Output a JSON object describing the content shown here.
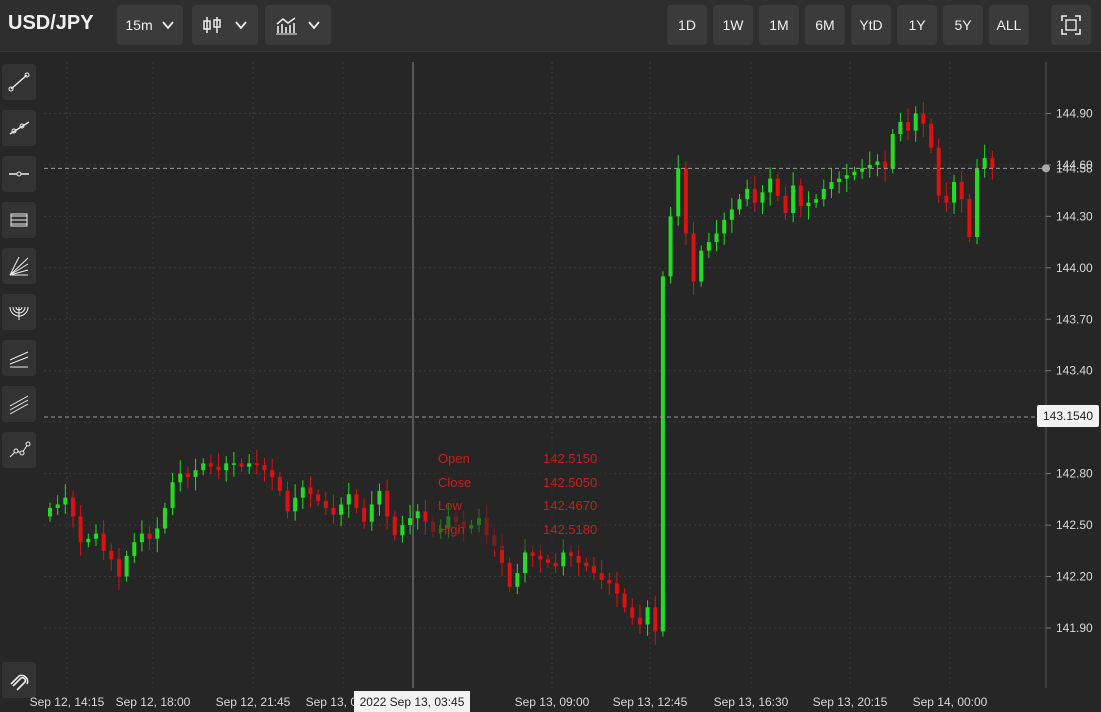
{
  "toolbar": {
    "symbol": "USD/JPY",
    "interval": "15m",
    "chart_type_icon": "candlestick-icon",
    "indicators_icon": "indicators-icon",
    "ranges": [
      "1D",
      "1W",
      "1M",
      "6M",
      "YtD",
      "1Y",
      "5Y",
      "ALL"
    ],
    "fullscreen_icon": "fullscreen-icon"
  },
  "sidebar": {
    "tools": [
      "trendline-icon",
      "ray-icon",
      "horizontal-line-icon",
      "channel-icon",
      "fan-icon",
      "arc-icon",
      "parallel-channel-icon",
      "pitchfork-icon",
      "path-icon"
    ],
    "bottom_tool": "magnet-icon"
  },
  "colors": {
    "up": "#22dd22",
    "down": "#dd1111",
    "background": "#262626",
    "grid": "#3a3a3a"
  },
  "tooltip": {
    "open_label": "Open",
    "open_value": "142.5150",
    "close_label": "Close",
    "close_value": "142.5050",
    "low_label": "Low",
    "low_value": "142.4670",
    "high_label": "High",
    "high_value": "142.5180"
  },
  "crosshair": {
    "price": "143.1540",
    "time": "2022 Sep 13, 03:45"
  },
  "last_price_label": "144.58",
  "chart_data": {
    "type": "candlestick",
    "y_ticks": [
      "144.90",
      "144.60",
      "144.30",
      "144.00",
      "143.70",
      "143.40",
      "143.10",
      "142.80",
      "142.50",
      "142.20",
      "141.90"
    ],
    "x_ticks": [
      "Sep 12, 14:15",
      "Sep 12, 18:00",
      "Sep 12, 21:45",
      "Sep 13, 03:45",
      "Sep 13, 09:00",
      "Sep 13, 12:45",
      "Sep 13, 16:30",
      "Sep 13, 20:15",
      "Sep 14, 00:00"
    ],
    "ylim": [
      141.55,
      145.2
    ],
    "last_price": 144.58,
    "closes": [
      142.6,
      142.62,
      142.66,
      142.55,
      142.4,
      142.42,
      142.45,
      142.35,
      142.3,
      142.2,
      142.32,
      142.4,
      142.45,
      142.42,
      142.48,
      142.6,
      142.75,
      142.8,
      142.78,
      142.82,
      142.86,
      142.84,
      142.82,
      142.86,
      142.86,
      142.84,
      142.86,
      142.85,
      142.82,
      142.78,
      142.7,
      142.58,
      142.66,
      142.72,
      142.68,
      142.64,
      142.6,
      142.56,
      142.62,
      142.68,
      142.6,
      142.52,
      142.62,
      142.7,
      142.55,
      142.44,
      142.5,
      142.54,
      142.58,
      142.52,
      142.46,
      142.48,
      142.55,
      142.52,
      142.48,
      142.5,
      142.54,
      142.44,
      142.38,
      142.28,
      142.14,
      142.22,
      142.34,
      142.32,
      142.3,
      142.28,
      142.26,
      142.34,
      142.32,
      142.28,
      142.26,
      142.22,
      142.18,
      142.16,
      142.1,
      142.02,
      141.96,
      141.92,
      142.02,
      141.88,
      143.95,
      144.3,
      144.58,
      144.2,
      143.92,
      144.1,
      144.15,
      144.2,
      144.28,
      144.34,
      144.4,
      144.46,
      144.38,
      144.44,
      144.52,
      144.42,
      144.32,
      144.48,
      144.36,
      144.38,
      144.4,
      144.46,
      144.5,
      144.52,
      144.54,
      144.56,
      144.58,
      144.6,
      144.62,
      144.58,
      144.78,
      144.85,
      144.8,
      144.9,
      144.84,
      144.7,
      144.42,
      144.38,
      144.5,
      144.4,
      144.18,
      144.58,
      144.64,
      144.58
    ]
  }
}
